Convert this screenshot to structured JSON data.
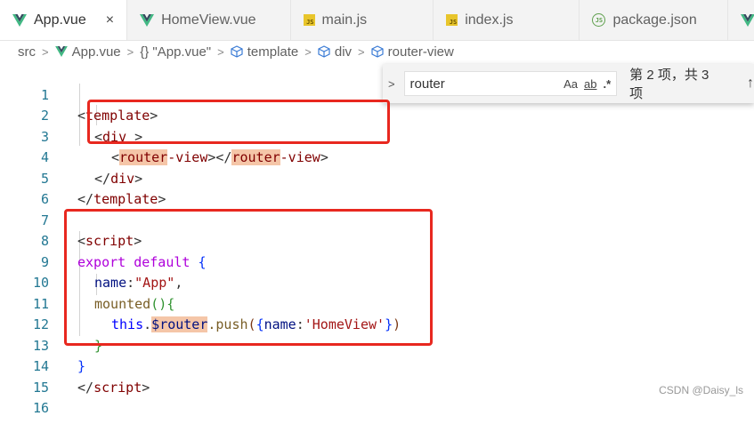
{
  "tabs": [
    {
      "label": "App.vue",
      "icon": "vue-icon",
      "active": true,
      "close": "×"
    },
    {
      "label": "HomeView.vue",
      "icon": "vue-icon",
      "active": false
    },
    {
      "label": "main.js",
      "icon": "js-icon",
      "active": false
    },
    {
      "label": "index.js",
      "icon": "js-icon",
      "active": false
    },
    {
      "label": "package.json",
      "icon": "node-icon",
      "active": false
    },
    {
      "label": "V",
      "icon": "vue-icon",
      "active": false
    }
  ],
  "icons": {
    "js_badge": "JS",
    "node_badge": "JS"
  },
  "breadcrumb": {
    "items": [
      "src",
      "App.vue",
      "{} \"App.vue\"",
      "template",
      "div",
      "router-view"
    ],
    "separator": ">"
  },
  "find_widget": {
    "toggle": ">",
    "query": "router",
    "match_case": "Aa",
    "whole_word": "ab",
    "regex": ".*",
    "result": "第 2 项，共 3 项",
    "prev": "↑"
  },
  "line_numbers": [
    "1",
    "2",
    "3",
    "4",
    "5",
    "6",
    "7",
    "8",
    "9",
    "10",
    "11",
    "12",
    "13",
    "14",
    "15",
    "16"
  ],
  "code": {
    "l1_open": "<",
    "l1_tag": "template",
    "l1_close": ">",
    "l2_open": "<",
    "l2_tag": "div",
    "l2_close": " >",
    "l3_a": "<",
    "l3_b": "router",
    "l3_c": "-view",
    "l3_d": "></",
    "l3_e": "router",
    "l3_f": "-view",
    "l3_g": ">",
    "l4_open": "</",
    "l4_tag": "div",
    "l4_close": ">",
    "l5_open": "</",
    "l5_tag": "template",
    "l5_close": ">",
    "l7_open": "<",
    "l7_tag": "script",
    "l7_close": ">",
    "l8_kw1": "export",
    "l8_kw2": "default",
    "l8_brace": "{",
    "l9_prop": "name",
    "l9_colon": ":",
    "l9_str": "\"App\"",
    "l9_comma": ",",
    "l10_fn": "mounted",
    "l10_paren": "()",
    "l10_brace": "{",
    "l11_this": "this",
    "l11_dot": ".",
    "l11_dollar": "$",
    "l11_router": "router",
    "l11_push": ".push",
    "l11_p1": "(",
    "l11_b1": "{",
    "l11_prop": "name",
    "l11_colon": ":",
    "l11_str": "'HomeView'",
    "l11_b2": "}",
    "l11_p2": ")",
    "l12_brace": "}",
    "l13_brace": "}",
    "l14_open": "</",
    "l14_tag": "script",
    "l14_close": ">"
  },
  "watermark": "CSDN @Daisy_ls",
  "colors": {
    "annotation": "#e8281f",
    "match_highlight": "#f5c6a8",
    "line_number": "#237893"
  }
}
